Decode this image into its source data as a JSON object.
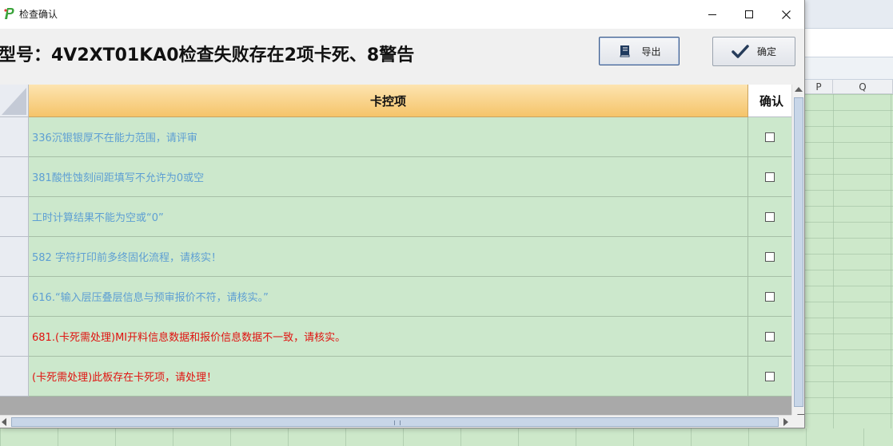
{
  "window": {
    "title": "检查确认",
    "heading": "型号：4V2XT01KA0检查失败存在2项卡死、8警告"
  },
  "buttons": {
    "export_label": "导出",
    "ok_label": "确定"
  },
  "table": {
    "columns": [
      "卡控项",
      "确认"
    ],
    "rows": [
      {
        "text": "336沉银银厚不在能力范围，请评审",
        "color": "#5e9fd3",
        "checked": false
      },
      {
        "text": "381酸性蚀刻间距填写不允许为0或空",
        "color": "#5e9fd3",
        "checked": false
      },
      {
        "text": "工时计算结果不能为空或“0”",
        "color": "#5e9fd3",
        "checked": false
      },
      {
        "text": "582 字符打印前多终固化流程，请核实！",
        "color": "#5e9fd3",
        "checked": false
      },
      {
        "text": "616.“输入层压叠层信息与预审报价不符，请核实。”",
        "color": "#5e9fd3",
        "checked": false
      },
      {
        "text": "681.(卡死需处理)MI开料信息数据和报价信息数据不一致，请核实。",
        "color": "#e0120f",
        "checked": false
      },
      {
        "text": "(卡死需处理)此板存在卡死项，请处理！",
        "color": "#e0120f",
        "checked": false
      }
    ]
  },
  "background_sheet": {
    "col_headers": [
      "P",
      "Q"
    ]
  },
  "colors": {
    "header_gradient_top": "#fde4b0",
    "header_gradient_bottom": "#f5c46a",
    "row_background": "#cce8cc",
    "warning_text": "#5e9fd3",
    "fatal_text": "#e0120f"
  }
}
